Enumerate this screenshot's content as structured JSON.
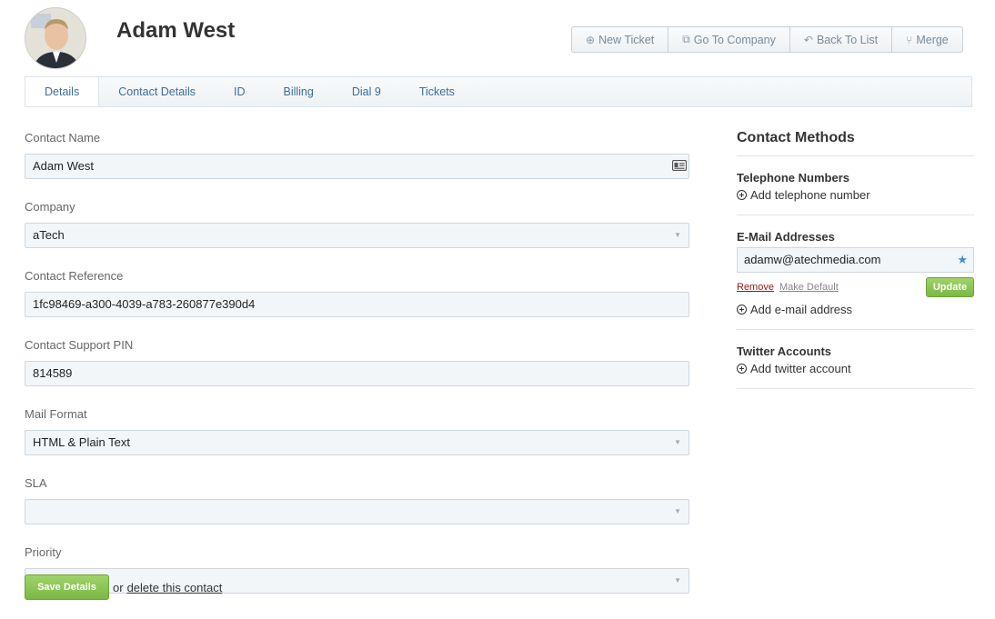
{
  "contact": {
    "name": "Adam West"
  },
  "toolbar": {
    "new_ticket": "New Ticket",
    "go_to_company": "Go To Company",
    "back_to_list": "Back To List",
    "merge": "Merge"
  },
  "tabs": [
    "Details",
    "Contact Details",
    "ID",
    "Billing",
    "Dial 9",
    "Tickets"
  ],
  "form": {
    "contact_name": {
      "label": "Contact Name",
      "value": "Adam West"
    },
    "company": {
      "label": "Company",
      "value": "aTech"
    },
    "contact_reference": {
      "label": "Contact Reference",
      "value": "1fc98469-a300-4039-a783-260877e390d4"
    },
    "support_pin": {
      "label": "Contact Support PIN",
      "value": "814589"
    },
    "mail_format": {
      "label": "Mail Format",
      "value": "HTML & Plain Text"
    },
    "sla": {
      "label": "SLA",
      "value": ""
    },
    "priority": {
      "label": "Priority",
      "value": ""
    },
    "save_label": "Save Details",
    "or_text": "or",
    "delete_label": "delete this contact"
  },
  "contact_methods": {
    "title": "Contact Methods",
    "telephone": {
      "title": "Telephone Numbers",
      "add_label": "Add telephone number"
    },
    "email": {
      "title": "E-Mail Addresses",
      "value": "adamw@atechmedia.com",
      "remove_label": "Remove",
      "make_default_label": "Make Default",
      "update_label": "Update",
      "add_label": "Add e-mail address"
    },
    "twitter": {
      "title": "Twitter Accounts",
      "add_label": "Add twitter account"
    }
  },
  "colors": {
    "accent": "#3b6e9a",
    "button_green": "#7bb843",
    "star": "#3a8fd6"
  }
}
